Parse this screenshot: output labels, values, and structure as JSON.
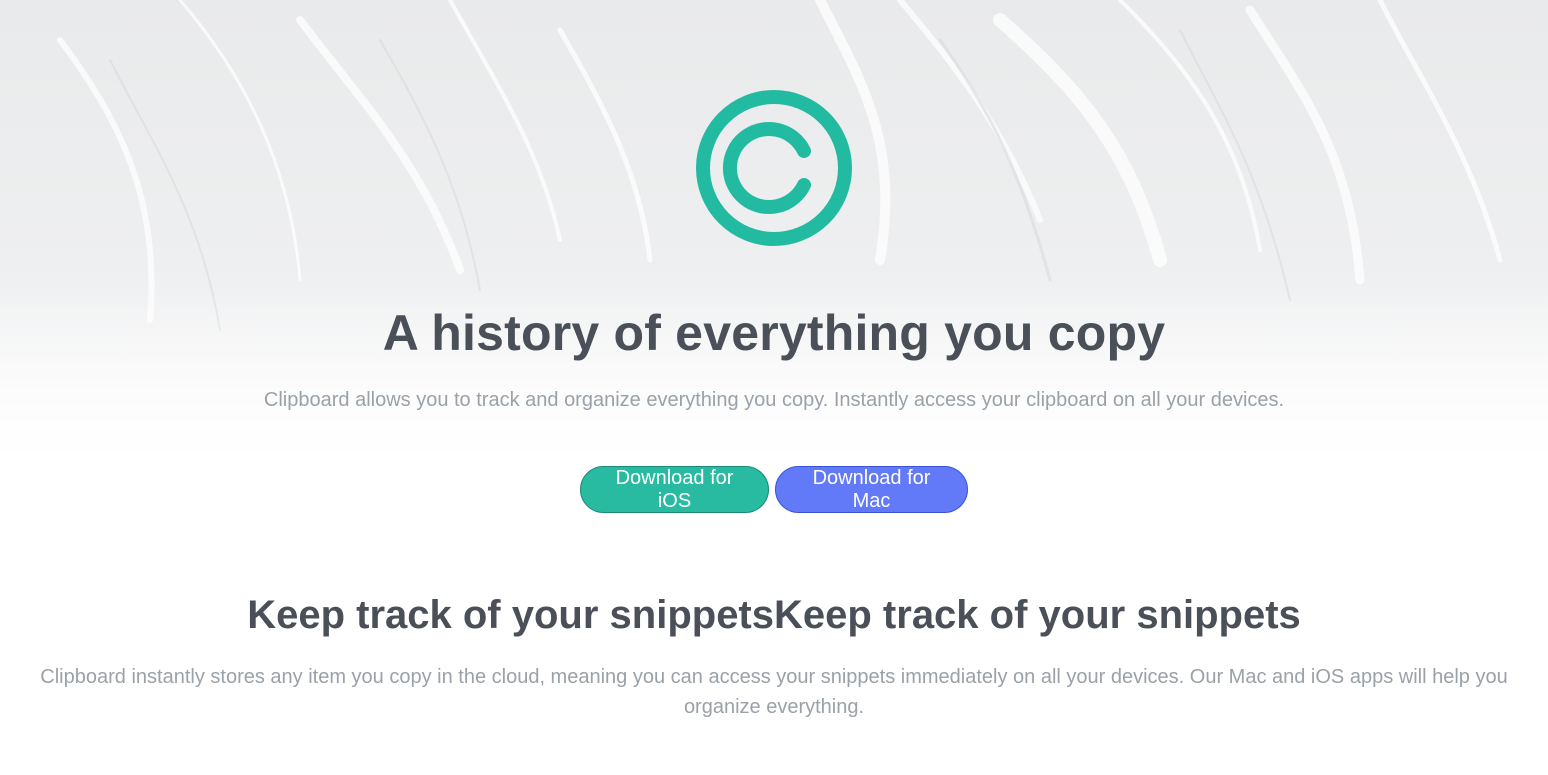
{
  "colors": {
    "accent_teal": "#28bba2",
    "accent_blue": "#6279f8",
    "heading": "#4a4f58",
    "body_text": "#9aa1a8"
  },
  "hero": {
    "logo_icon": "copyright-c-icon",
    "title": "A history of everything you copy",
    "subtitle": "Clipboard allows you to track and organize everything you copy. Instantly access your clipboard on all your devices.",
    "buttons": {
      "ios_label": "Download for iOS",
      "mac_label": "Download for Mac"
    }
  },
  "feature": {
    "title": "Keep track of your snippetsKeep track of your snippets",
    "text": "Clipboard instantly stores any item you copy in the cloud, meaning you can access your snippets immediately on all your devices. Our Mac and iOS apps will help you organize everything."
  }
}
